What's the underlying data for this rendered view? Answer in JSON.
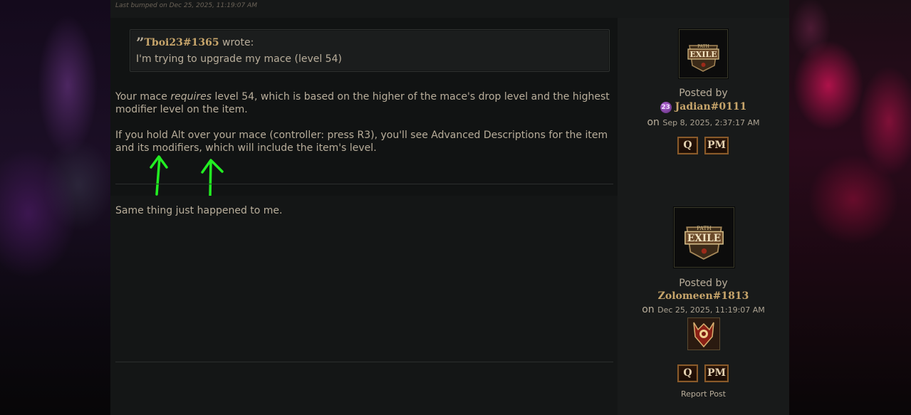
{
  "meta": {
    "last_bumped": "Last bumped on Dec 25, 2025, 11:19:07 AM"
  },
  "posts": [
    {
      "quote": {
        "mark": "”",
        "author": "Tboi23#1365",
        "wrote": " wrote:",
        "text": "I'm trying to upgrade my mace (level 54)"
      },
      "body": {
        "p1_a": "Your mace ",
        "p1_em": "requires",
        "p1_b": " level 54, which is based on the higher of the mace's drop level and the highest modifier level on the item.",
        "p2": "If you hold Alt over your mace (controller: press R3), you'll see Advanced Descriptions for the item and its modifiers, which will include the item's level."
      },
      "author": {
        "posted_by": "Posted by",
        "badge": "23",
        "name": "Jadian#0111",
        "on": "on",
        "date": "Sep 8, 2025, 2:37:17 AM",
        "avatar_icon": "path-of-exile-logo-icon"
      },
      "actions": {
        "quote": "Q",
        "pm": "PM"
      }
    },
    {
      "body": {
        "p1": "Same thing just happened to me."
      },
      "author": {
        "posted_by": "Posted by",
        "name": "Zolomeen#1813",
        "on": "on",
        "date": "Dec 25, 2025, 11:19:07 AM",
        "avatar_icon": "path-of-exile-logo-icon",
        "achievement_icon": "demon-crest-icon"
      },
      "actions": {
        "quote": "Q",
        "pm": "PM",
        "report": "Report Post"
      }
    }
  ],
  "colors": {
    "text": "#b9ae9b",
    "author_gold": "#c7a56b",
    "annotation_arrow": "#22ee22"
  }
}
